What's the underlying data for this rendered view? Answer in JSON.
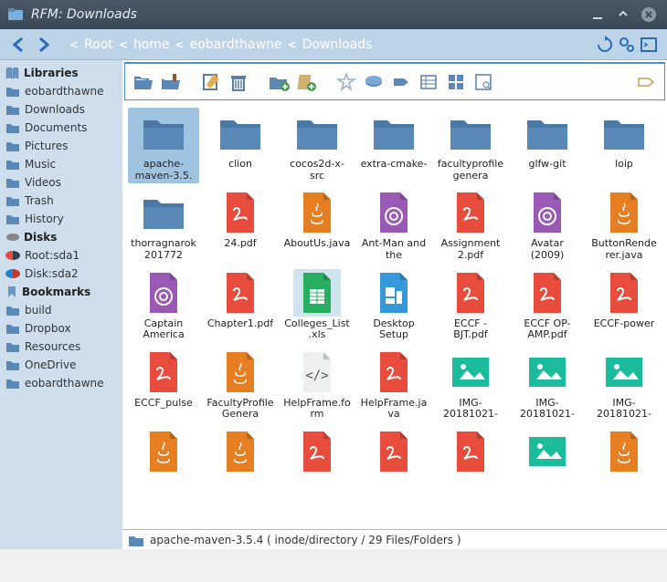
{
  "window": {
    "title": "RFM: Downloads"
  },
  "path": {
    "crumbs": [
      "Root",
      "home",
      "eobardthawne",
      "Downloads"
    ]
  },
  "sidebar": {
    "libraries_hdr": "Libraries",
    "libraries": [
      "eobardthawne",
      "Downloads",
      "Documents",
      "Pictures",
      "Music",
      "Videos",
      "Trash",
      "History"
    ],
    "disks_hdr": "Disks",
    "disks": [
      "Root:sda1",
      "Disk:sda2"
    ],
    "bookmarks_hdr": "Bookmarks",
    "bookmarks": [
      "build",
      "Dropbox",
      "Resources",
      "OneDrive",
      "eobardthawne"
    ]
  },
  "items": [
    {
      "name": "apache-maven-3.5.",
      "type": "folder",
      "sel": true
    },
    {
      "name": "clion",
      "type": "folder"
    },
    {
      "name": "cocos2d-x-src",
      "type": "folder"
    },
    {
      "name": "extra-cmake-",
      "type": "folder"
    },
    {
      "name": "facultyprofilegenera",
      "type": "folder"
    },
    {
      "name": "glfw-git",
      "type": "folder"
    },
    {
      "name": "loip",
      "type": "folder"
    },
    {
      "name": "thorragnarok201772",
      "type": "folder"
    },
    {
      "name": "24.pdf",
      "type": "pdf"
    },
    {
      "name": "AboutUs.java",
      "type": "java"
    },
    {
      "name": "Ant-Man and the",
      "type": "torrent"
    },
    {
      "name": "Assignment 2.pdf",
      "type": "pdf"
    },
    {
      "name": "Avatar (2009)",
      "type": "torrent"
    },
    {
      "name": "ButtonRenderer.java",
      "type": "java"
    },
    {
      "name": "Captain America",
      "type": "torrent"
    },
    {
      "name": "Chapter1.pdf",
      "type": "pdf"
    },
    {
      "name": "Colleges_List.xls",
      "type": "xls",
      "hl": true
    },
    {
      "name": "Desktop Setup",
      "type": "form"
    },
    {
      "name": "ECCF - BJT.pdf",
      "type": "pdf"
    },
    {
      "name": "ECCF OP-AMP.pdf",
      "type": "pdf"
    },
    {
      "name": "ECCF-power",
      "type": "pdf"
    },
    {
      "name": "ECCF_pulse",
      "type": "pdf"
    },
    {
      "name": "FacultyProfileGenera",
      "type": "java"
    },
    {
      "name": "HelpFrame.form",
      "type": "code"
    },
    {
      "name": "HelpFrame.java",
      "type": "pdf"
    },
    {
      "name": "IMG-20181021-",
      "type": "img"
    },
    {
      "name": "IMG-20181021-",
      "type": "img"
    },
    {
      "name": "IMG-20181021-",
      "type": "img"
    },
    {
      "name": "",
      "type": "java"
    },
    {
      "name": "",
      "type": "java"
    },
    {
      "name": "",
      "type": "pdf"
    },
    {
      "name": "",
      "type": "pdf"
    },
    {
      "name": "",
      "type": "pdf"
    },
    {
      "name": "",
      "type": "img"
    },
    {
      "name": "",
      "type": "java"
    }
  ],
  "status": {
    "text": "apache-maven-3.5.4 ( inode/directory / 29 Files/Folders )"
  }
}
